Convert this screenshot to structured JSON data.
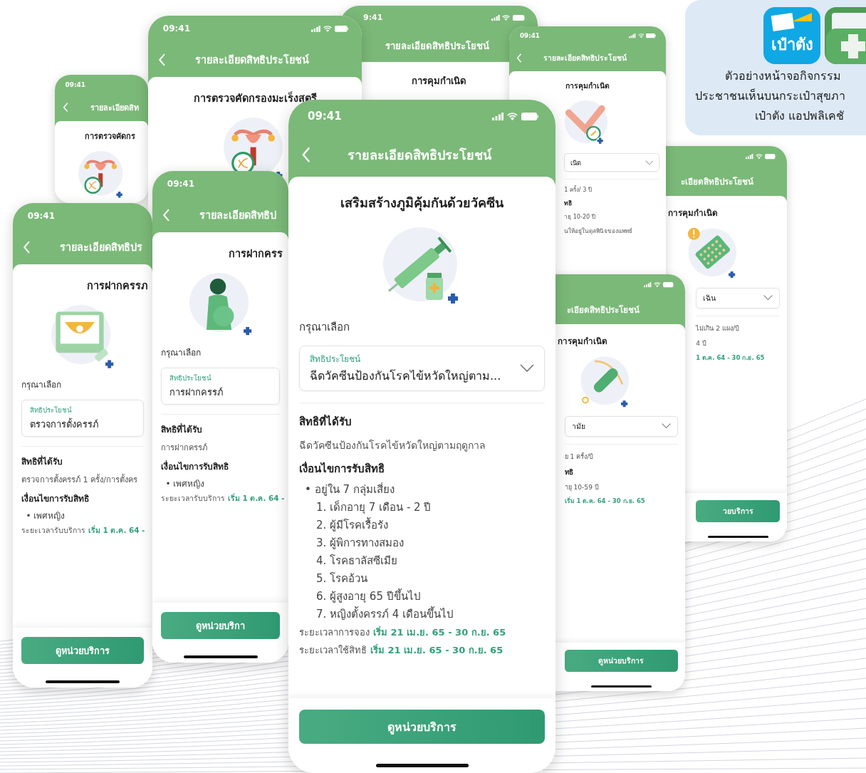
{
  "promo_card": {
    "app_icons": [
      {
        "kind": "wallet",
        "label": "เป๋าตัง"
      },
      {
        "kind": "health"
      }
    ],
    "caption": [
      "ตัวอย่างหน้าจอกิจกรรม",
      "ประชาชนเห็นบนกระเป๋าสุขภา",
      "เป๋าตัง แอปพลิเคชั"
    ]
  },
  "phones": [
    {
      "time": "09:41",
      "back": true,
      "title": "รายละเอียดสิท",
      "subtitle": "การตรวจคัดกร",
      "illustration": {
        "kind": "uterus-test"
      }
    },
    {
      "time": "9:41",
      "status_icons": true,
      "back": false,
      "title": "รายละเอียดสิทธิประโยชน์",
      "subtitle": "การคุมกำเนิด"
    },
    {
      "time": "09:41",
      "status_icons": true,
      "back": true,
      "title": "รายละเอียดสิทธิประโยชน์",
      "subtitle": "การตรวจคัดกรองมะเร็งสตรี",
      "illustration": {
        "kind": "uterus-dna"
      }
    },
    {
      "time": "09:41",
      "status_icons": true,
      "back": true,
      "title": "รายละเอียดสิทธิประโยชน์",
      "subtitle": "การคุมกำเนิด",
      "illustration": {
        "kind": "arm"
      },
      "body": [
        {
          "kind": "field",
          "value": "เนิด",
          "caret": true
        },
        {
          "kind": "text",
          "text": "1 ครั้ง/ 3 ปี"
        },
        {
          "kind": "heading",
          "text": "ทธิ"
        },
        {
          "kind": "text",
          "text": "ายุ 10-20 ปี"
        },
        {
          "kind": "text",
          "text": "นให้อยู่ในดุลพินิจของแพทย์"
        }
      ]
    },
    {
      "status_icons": true,
      "back": false,
      "title": "ะเอียดสิทธิประโยชน์",
      "subtitle": "การคุมกำเนิด",
      "illustration": {
        "kind": "pills"
      },
      "body": [
        {
          "kind": "field",
          "value": "เฉิน",
          "caret": true
        },
        {
          "kind": "text",
          "text": "ไม่เกิน 2 แผง/ปี"
        },
        {
          "kind": "text",
          "text": "4 ปี"
        },
        {
          "kind": "period",
          "value": "1 ต.ค. 64 - 30 ก.ย. 65"
        }
      ],
      "button": "วยบริการ"
    },
    {
      "time": "09:41",
      "back": true,
      "title": "รายละเอียดสิทธิปร",
      "subtitle": "การฝากครรภ",
      "illustration": {
        "kind": "ultrasound"
      },
      "body": [
        {
          "kind": "prompt",
          "text": "กรุณาเลือก"
        },
        {
          "kind": "field",
          "label": "สิทธิประโยชน์",
          "value": "ตรวจการตั้งครรภ์",
          "caret": false
        },
        {
          "kind": "heading",
          "text": "สิทธิที่ได้รับ"
        },
        {
          "kind": "text",
          "text": "ตรวจการตั้งครรภ์ 1 ครั้ง/การตั้งคร"
        },
        {
          "kind": "heading",
          "text": "เงื่อนไขการรับสิทธิ"
        },
        {
          "kind": "bullet",
          "text": "• เพศหญิง"
        },
        {
          "kind": "period",
          "label": "ระยะเวลารับบริการ",
          "value": "เริ่ม 1 ต.ค. 64 -"
        }
      ],
      "button": "ดูหน่วยบริการ"
    },
    {
      "time": "09:41",
      "back": true,
      "title": "รายละเอียดสิทธิป",
      "subtitle": "การฝากครร",
      "illustration": {
        "kind": "pregnant"
      },
      "body": [
        {
          "kind": "prompt",
          "text": "กรุณาเลือก"
        },
        {
          "kind": "field",
          "label": "สิทธิประโยชน์",
          "value": "การฝากครรภ์",
          "caret": false
        },
        {
          "kind": "heading",
          "text": "สิทธิที่ได้รับ"
        },
        {
          "kind": "text",
          "text": "การฝากครรภ์"
        },
        {
          "kind": "heading",
          "text": "เงื่อนไขการรับสิทธิ"
        },
        {
          "kind": "bullet",
          "text": "• เพศหญิง"
        },
        {
          "kind": "period",
          "label": "ระยะเวลารับบริการ",
          "value": "เริ่ม 1 ต.ค. 64 -"
        }
      ],
      "button": "ดูหน่วยบริกา"
    },
    {
      "status_icons": true,
      "back": false,
      "title": "ะเอียดสิทธิประโยชน์",
      "subtitle": "การคุมกำเนิด",
      "illustration": {
        "kind": "iud"
      },
      "body": [
        {
          "kind": "field",
          "value": "ามัย",
          "caret": true
        },
        {
          "kind": "text",
          "text": "ย 1 ครั้ง/ปี"
        },
        {
          "kind": "heading",
          "text": "ทธิ"
        },
        {
          "kind": "text",
          "text": "ายุ 10-59 ปี"
        },
        {
          "kind": "period",
          "value": "เริ่ม 1 ต.ค. 64 - 30 ก.ย. 65"
        }
      ],
      "button": "ดูหน่วยบริการ"
    },
    {
      "time": "09:41",
      "status_icons": true,
      "back": true,
      "title": "รายละเอียดสิทธิประโยชน์",
      "subtitle": "เสริมสร้างภูมิคุ้มกันด้วยวัคซีน",
      "illustration": {
        "kind": "syringe"
      },
      "body": [
        {
          "kind": "prompt",
          "text": "กรุณาเลือก"
        },
        {
          "kind": "field",
          "label": "สิทธิประโยชน์",
          "value": "ฉีดวัคซีนป้องกันโรคไข้หวัดใหญ่ตาม...",
          "caret": true
        },
        {
          "kind": "heading",
          "text": "สิทธิที่ได้รับ"
        },
        {
          "kind": "text",
          "text": "ฉีดวัคซีนป้องกันโรคไข้หวัดใหญ่ตามฤดูกาล"
        },
        {
          "kind": "heading",
          "text": "เงื่อนไขการรับสิทธิ"
        },
        {
          "kind": "bullet",
          "text": "• อยู่ใน 7 กลุ่มเสี่ยง"
        },
        {
          "kind": "numbered",
          "text": "1. เด็กอายุ 7 เดือน - 2 ปี"
        },
        {
          "kind": "numbered",
          "text": "2. ผู้มีโรคเรื้อรัง"
        },
        {
          "kind": "numbered",
          "text": "3. ผู้พิการทางสมอง"
        },
        {
          "kind": "numbered",
          "text": "4. โรคธาลัสซีเมีย"
        },
        {
          "kind": "numbered",
          "text": "5. โรคอ้วน"
        },
        {
          "kind": "numbered",
          "text": "6. ผู้สูงอายุ 65 ปีขึ้นไป"
        },
        {
          "kind": "numbered",
          "text": "7. หญิงตั้งครรภ์ 4 เดือนขึ้นไป"
        },
        {
          "kind": "period",
          "label": "ระยะเวลาการจอง",
          "value": "เริ่ม 21 เม.ย. 65 - 30 ก.ย. 65"
        },
        {
          "kind": "period",
          "label": "ระยะเวลาใช้สิทธิ",
          "value": "เริ่ม 21 เม.ย. 65 - 30 ก.ย. 65"
        }
      ],
      "button": "ดูหน่วยบริการ"
    }
  ]
}
